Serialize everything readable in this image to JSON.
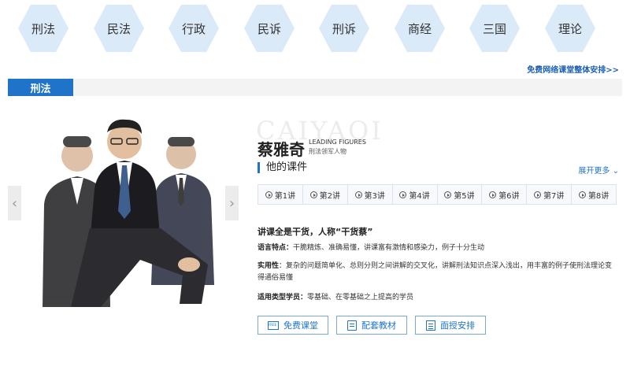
{
  "nav": {
    "items": [
      "刑法",
      "民法",
      "行政",
      "民诉",
      "刑诉",
      "商经",
      "三国",
      "理论"
    ]
  },
  "free_schedule_link": "免费网络课堂整体安排>>",
  "section": {
    "tab_label": "刑法"
  },
  "teacher": {
    "watermark": "CAIYAQI",
    "name": "蔡雅奇",
    "title_en": "LEADING FIGURES",
    "title_cn": "刑法领军人物"
  },
  "courses": {
    "heading": "他的课件",
    "expand_label": "展开更多",
    "lectures": [
      "第1讲",
      "第2讲",
      "第3讲",
      "第4讲",
      "第5讲",
      "第6讲",
      "第7讲",
      "第8讲"
    ]
  },
  "profile": {
    "tagline": "讲课全是干货，人称“干货蔡”",
    "style_label": "语言特点：",
    "style_text": "干脆精炼、准确易懂，讲课富有激情和感染力，例子十分生动",
    "practical_label": "实用性",
    "practical_text": "：复杂的问题简单化、总则分则之间讲解的交叉化，讲解刑法知识点深入浅出，用丰富的例子使刑法理论变得通俗易懂",
    "audience_label": "适用类型学员：",
    "audience_text": "零基础、在零基础之上提高的学员"
  },
  "buttons": {
    "free_class": "免费课堂",
    "materials": "配套教材",
    "schedule": "面授安排"
  },
  "colors": {
    "accent": "#1f73c9",
    "hex_bg": "#e2f0fb"
  }
}
